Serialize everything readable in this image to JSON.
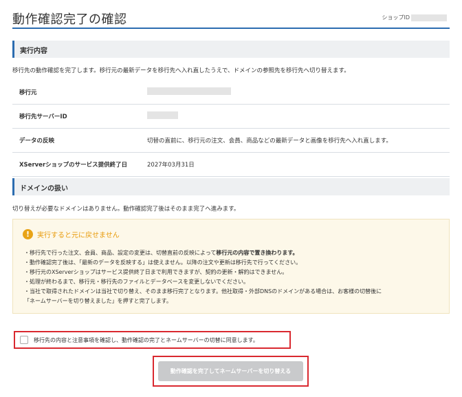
{
  "page": {
    "title": "動作確認完了の確認",
    "shop_id_label": "ショップID",
    "shop_id_value": ""
  },
  "execution": {
    "heading": "実行内容",
    "description": "移行先の動作確認を完了します。移行元の最新データを移行先へ入れ直したうえで、ドメインの参照先を移行先へ切り替えます。",
    "rows": [
      {
        "label": "移行元",
        "value": ""
      },
      {
        "label": "移行先サーバーID",
        "value": ""
      },
      {
        "label": "データの反映",
        "value": "切替の直前に、移行元の注文、会員、商品などの最新データと画像を移行先へ入れ直します。"
      },
      {
        "label": "XServerショップのサービス提供終了日",
        "value": "2027年03月31日"
      }
    ]
  },
  "domain": {
    "heading": "ドメインの扱い",
    "description": "切り替えが必要なドメインはありません。動作確認完了後はそのまま完了へ進みます。"
  },
  "warning": {
    "icon": "exclamation-icon",
    "title": "実行すると元に戻せません",
    "line1_pre": "・移行先で行った注文、会員、商品、設定の変更は、切替直前の反映によって",
    "line1_bold": "移行元の内容で置き換わります。",
    "line2": "・動作確認完了後は、「最新のデータを反映する」は使えません。以降の注文や更新は移行先で行ってください。",
    "line3": "・移行元のXServerショップはサービス提供終了日まで利用できますが、契約の更新・解約はできません。",
    "line4": "・処理が終わるまで、移行元・移行先のファイルとデータベースを変更しないでください。",
    "line5": "・当社で取得されたドメインは当社で切り替え、そのまま移行完了となります。他社取得・外部DNSのドメインがある場合は、お客様の切替後に",
    "line6": "「ネームサーバーを切り替えました」を押すと完了します。"
  },
  "agreement": {
    "label": "移行先の内容と注意事項を確認し、動作確認の完了とネームサーバーの切替に同意します。",
    "checked": false
  },
  "submit": {
    "label": "動作確認を完了してネームサーバーを切り替える"
  },
  "colors": {
    "accent": "#2b6cb0",
    "warning": "#e8a317",
    "highlight": "#d9282f"
  }
}
